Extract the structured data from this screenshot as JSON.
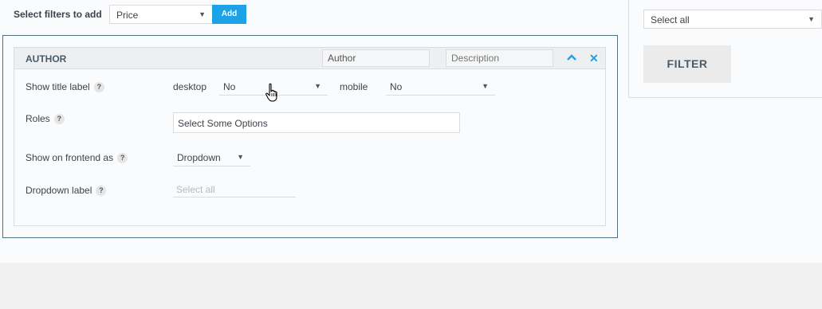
{
  "toolbar": {
    "add_label": "Select filters to add",
    "filter_select_value": "Price",
    "add_button": "Add"
  },
  "filter_block": {
    "title": "AUTHOR",
    "name_value": "Author",
    "description_placeholder": "Description",
    "rows": {
      "show_title_label": {
        "label": "Show title label",
        "desktop_label": "desktop",
        "desktop_value": "No",
        "mobile_label": "mobile",
        "mobile_value": "No"
      },
      "roles": {
        "label": "Roles",
        "value": "Select Some Options"
      },
      "show_on_frontend": {
        "label": "Show on frontend as",
        "value": "Dropdown"
      },
      "dropdown_label": {
        "label": "Dropdown label",
        "placeholder": "Select all"
      }
    },
    "help_glyph": "?"
  },
  "preview": {
    "select_value": "Select all",
    "filter_button": "FILTER"
  },
  "colors": {
    "accent": "#1ea2e6",
    "panel_border": "#4d7383",
    "header_bg": "#eeeff1",
    "filter_button_bg": "#ebebeb"
  },
  "icons": {
    "caret": "caret-down-icon",
    "collapse": "chevron-up-icon",
    "close": "close-icon",
    "help": "help-icon",
    "pointer": "hand-pointer-icon"
  }
}
